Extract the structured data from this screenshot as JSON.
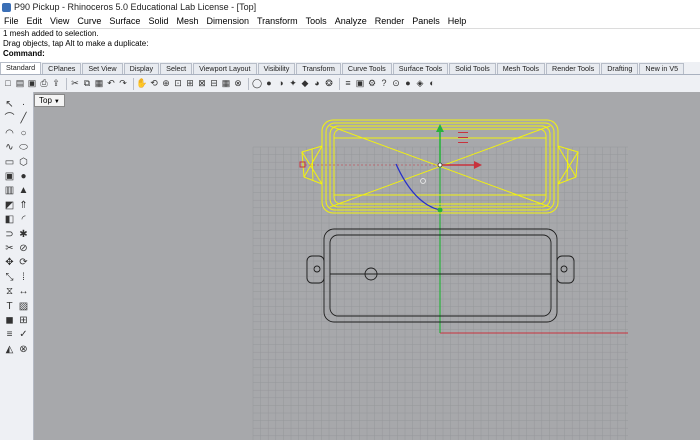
{
  "window": {
    "title": "P90 Pickup - Rhinoceros 5.0 Educational Lab License - [Top]"
  },
  "menu": [
    "File",
    "Edit",
    "View",
    "Curve",
    "Surface",
    "Solid",
    "Mesh",
    "Dimension",
    "Transform",
    "Tools",
    "Analyze",
    "Render",
    "Panels",
    "Help"
  ],
  "command_history": [
    "1 mesh added to selection.",
    "Drag objects, tap Alt to make a duplicate:"
  ],
  "command_prompt": "Command:",
  "command_input_value": "",
  "toolbar_tabs": [
    "Standard",
    "CPlanes",
    "Set View",
    "Display",
    "Select",
    "Viewport Layout",
    "Visibility",
    "Transform",
    "Curve Tools",
    "Surface Tools",
    "Solid Tools",
    "Mesh Tools",
    "Render Tools",
    "Drafting",
    "New in V5"
  ],
  "active_tab": "Standard",
  "toolbar_icons": [
    "new-icon",
    "open-icon",
    "save-icon",
    "print-icon",
    "import-icon",
    "cut-icon",
    "copy-icon",
    "paste-icon",
    "undo-icon",
    "redo-icon",
    "pan-icon",
    "rotate-view-icon",
    "zoom-dynamic-icon",
    "zoom-window-icon",
    "zoom-extents-icon",
    "zoom-selected-icon",
    "four-views-icon",
    "grid-icon",
    "car-icon",
    "wireframe-icon",
    "shaded-icon",
    "rendered-icon",
    "lights-icon",
    "material-icon",
    "render-icon",
    "color-wheel-icon",
    "layers-icon",
    "properties-icon",
    "options-icon",
    "help-icon",
    "osnap-icon",
    "record-icon",
    "plugin-icon",
    "snapshot-icon"
  ],
  "sidebar_icons": [
    "select-icon",
    "point-icon",
    "polyline-icon",
    "line-icon",
    "arc-icon",
    "circle-icon",
    "curve-icon",
    "ellipse-icon",
    "rectangle-icon",
    "polygon-icon",
    "box-icon",
    "sphere-icon",
    "cylinder-icon",
    "cone-icon",
    "surface-icon",
    "extrude-icon",
    "boolean-icon",
    "fillet-icon",
    "join-icon",
    "explode-icon",
    "trim-icon",
    "split-icon",
    "move-icon",
    "rotate-icon",
    "scale-icon",
    "array-icon",
    "mirror-icon",
    "dimension-icon",
    "text-icon",
    "hatch-icon",
    "block-icon",
    "group-icon",
    "layer-icon",
    "check-icon",
    "analyze-icon",
    "mesh-icon"
  ],
  "viewport": {
    "label": "Top"
  },
  "colors": {
    "grid": "#96989b",
    "selection": "#f2f20e",
    "x_axis": "#c8323c",
    "y_axis": "#28b23c",
    "curve": "#2832c8"
  }
}
